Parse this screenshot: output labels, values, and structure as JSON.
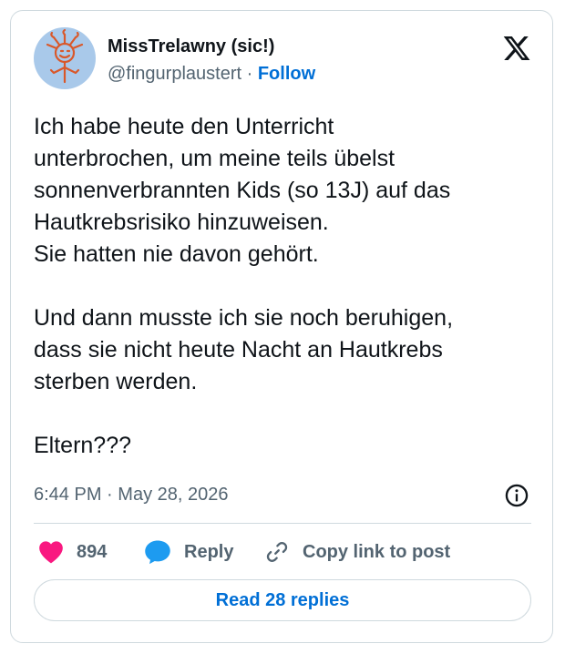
{
  "author": {
    "display_name": "MissTrelawny (sic!)",
    "handle": "@fingurplaustert",
    "separator": "·",
    "follow_label": "Follow"
  },
  "tweet": {
    "text": "Ich habe heute den Unterricht\nunterbrochen, um meine teils übelst\nsonnenverbrannten Kids (so 13J) auf das\nHautkrebsrisiko hinzuweisen.\nSie hatten nie davon gehört.\n\nUnd dann musste ich sie noch beruhigen,\ndass sie nicht heute Nacht an Hautkrebs\nsterben werden.\n\nEltern???",
    "time": "6:44 PM",
    "separator": "·",
    "date": "May 28, 2026"
  },
  "actions": {
    "like_count": "894",
    "reply_label": "Reply",
    "copy_label": "Copy link to post"
  },
  "read_replies_label": "Read 28 replies",
  "icons": {
    "logo": "x-logo-icon",
    "info": "info-icon",
    "like": "heart-icon",
    "reply": "speech-bubble-icon",
    "copy": "link-icon"
  },
  "colors": {
    "text": "#0f1419",
    "secondary": "#536471",
    "link": "#006fd6",
    "like": "#f91880",
    "reply": "#1d9bf0",
    "border": "#cfd9de",
    "avatar_bg": "#a9c9ea"
  }
}
